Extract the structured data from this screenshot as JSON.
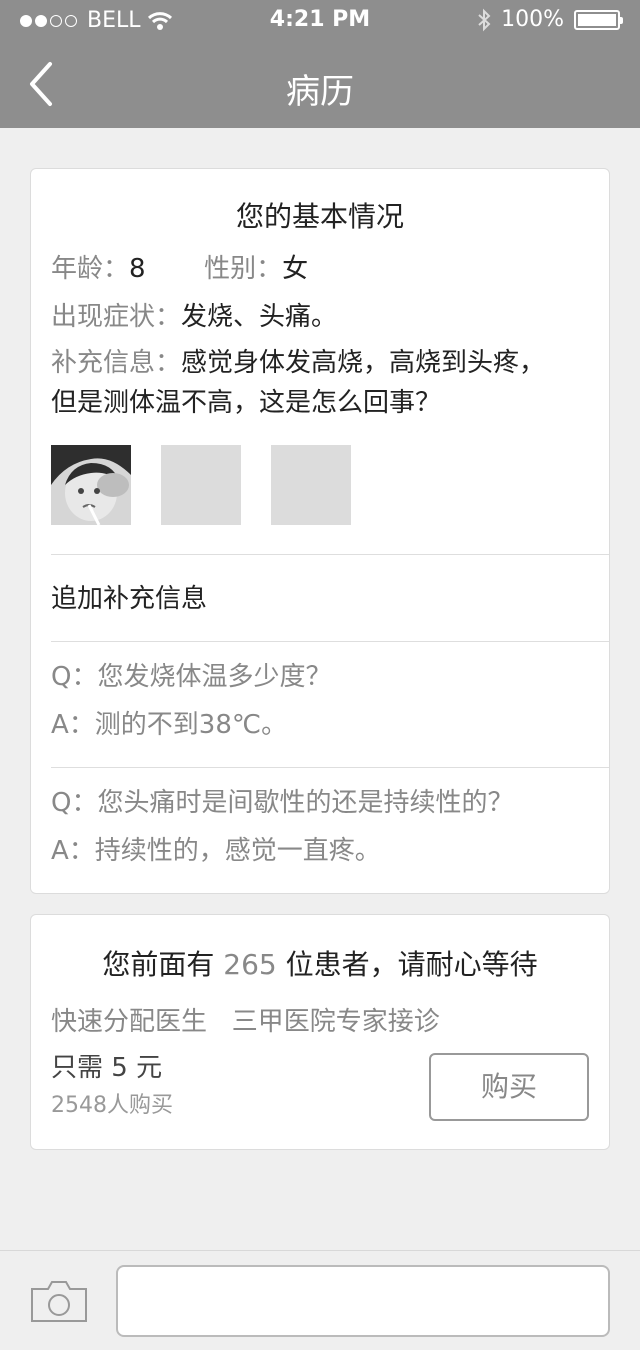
{
  "status_bar": {
    "carrier": "BELL",
    "time": "4:21 PM",
    "battery": "100%"
  },
  "nav": {
    "title": "病历"
  },
  "basic": {
    "title": "您的基本情况",
    "age_label": "年龄：",
    "age_value": "8",
    "gender_label": "性别：",
    "gender_value": "女",
    "symptoms_label": "出现症状：",
    "symptoms_value": "发烧、头痛。",
    "extra_label": "补充信息：",
    "extra_line1": "感觉身体发高烧，高烧到头疼，",
    "extra_line2": "但是测体温不高，这是怎么回事？"
  },
  "followup": {
    "title": "追加补充信息",
    "items": [
      {
        "q_prefix": "Q：",
        "q": "您发烧体温多少度？",
        "a_prefix": "A：",
        "a": "测的不到38℃。"
      },
      {
        "q_prefix": "Q：",
        "q": "您头痛时是间歇性的还是持续性的？",
        "a_prefix": "A：",
        "a": "持续性的，感觉一直疼。"
      }
    ]
  },
  "queue": {
    "before": "您前面有 ",
    "count": "265",
    "after": " 位患者，请耐心等待",
    "features": "快速分配医生   三甲医院专家接诊",
    "price": "只需 5 元",
    "buyers": "2548人购买",
    "buy_label": "购买"
  },
  "icons": {
    "back": "chevron-left-icon",
    "camera": "camera-icon",
    "wifi": "wifi-icon",
    "bluetooth": "bluetooth-icon",
    "battery": "battery-icon"
  }
}
